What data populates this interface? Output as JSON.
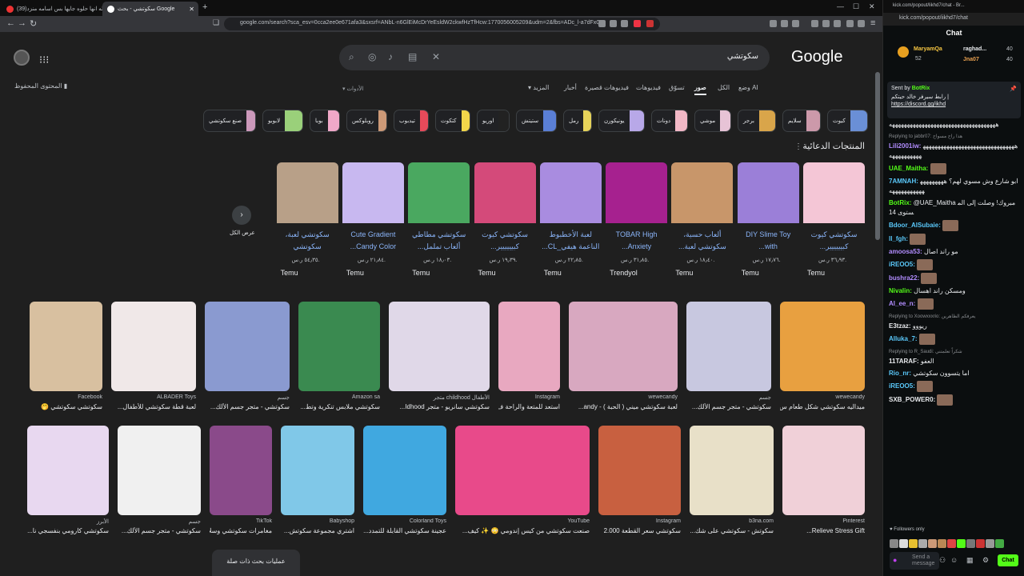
{
  "browser": {
    "tabs": [
      {
        "label": "(39)يالله انها حلوه جايها بس اسامه منزد"
      },
      {
        "label": "سكوتشي - بحث Google"
      }
    ],
    "url": "google.com/search?sca_esv=0cca2ee0e671afa3&sxsrf=ANbL-n6GlEiMcDrYeEsldW2ckwfHzTfHcw:1770056005209&udm=2&fbs=ADc_l-a7dFxQ..."
  },
  "google": {
    "logo": "Google",
    "query": "سكوتشي",
    "saved_content": "المحتوى المحفوظ",
    "tools": "الأدوات",
    "nav_tabs": [
      {
        "label": "وضع AI"
      },
      {
        "label": "الكل"
      },
      {
        "label": "صور"
      },
      {
        "label": "تسوّق"
      },
      {
        "label": "فيديوهات"
      },
      {
        "label": "فيديوهات قصيرة"
      },
      {
        "label": "أخبار"
      },
      {
        "label": "المزيد"
      }
    ],
    "chips": [
      {
        "label": "كيوت",
        "color": "#6a8fd6"
      },
      {
        "label": "سلايم",
        "color": "#c9a"
      },
      {
        "label": "برجر",
        "color": "#d9a54a"
      },
      {
        "label": "موشي",
        "color": "#e7c3d6"
      },
      {
        "label": "دونات",
        "color": "#f2b8c6"
      },
      {
        "label": "يونيكورن",
        "color": "#b8a8e8"
      },
      {
        "label": "رمل",
        "color": "#e6d35a"
      },
      {
        "label": "ستيتش",
        "color": "#5a7fd6"
      },
      {
        "label": "اوريو",
        "color": "#222"
      },
      {
        "label": "كتكوت",
        "color": "#f3d64a"
      },
      {
        "label": "تيدبوب",
        "color": "#e74a5a"
      },
      {
        "label": "روبلوكس",
        "color": "#c97"
      },
      {
        "label": "بوبا",
        "color": "#f0a8c8"
      },
      {
        "label": "لابوبو",
        "color": "#9ad07a"
      },
      {
        "label": "صنع سكوتشي",
        "color": "#c9b"
      }
    ],
    "sponsored_title": "المنتجات الدعائية",
    "view_all": "عرض الكل",
    "products": [
      {
        "title": "سكوتشي كيوت كبيييييير...",
        "price": "٣٦٫٩٣ ر.س.",
        "seller": "Temu",
        "color": "#f4c6d6"
      },
      {
        "title": "DIY Slime Toy with...",
        "price": "١٧٫٧٦ ر.س.",
        "seller": "Temu",
        "color": "#9b7fd8"
      },
      {
        "title": "ألعاب حسية، سكوتشي لعبة...",
        "price": "١٨٫٤٠ ر.س.",
        "seller": "Temu",
        "color": "#c8966a"
      },
      {
        "title": "TOBAR High Anxiety...",
        "price": "٣١٫٨٥ ر.س.",
        "seller": "Trendyol",
        "color": "#a6218f"
      },
      {
        "title": "لعبة الأخطبوط الناعمة هيفي_CL...",
        "price": "٢٢٫٨٥ ر.س.",
        "seller": "Temu",
        "color": "#a98ce0"
      },
      {
        "title": "سكوتشي كيوت كبيييييير...",
        "price": "١٩٫٣٩ ر.س.",
        "seller": "Temu",
        "color": "#d44a7a"
      },
      {
        "title": "سكوتشي مطاطي ألعاب تململ...",
        "price": "١٨٫٠٣ ر.س.",
        "seller": "Temu",
        "color": "#4aa860"
      },
      {
        "title": "Cute Gradient Candy Color...",
        "price": "٢١٫٨٤ ر.س.",
        "seller": "Temu",
        "color": "#c8b8f0"
      },
      {
        "title": "سكوتشي لعبة، سكوتشي للأطفال...",
        "price": "٥٤٫٣٥ ر.س.",
        "seller": "Temu",
        "color": "#b8a088"
      }
    ],
    "row1": [
      {
        "source": "wewecandy",
        "caption": "ميداليه سكوتشي شكل طعام س...",
        "color": "#e8a040"
      },
      {
        "source": "جسم",
        "caption": "سكوتشي - متجر جسم الألك...",
        "color": "#c8c8e0"
      },
      {
        "source": "wewecandy",
        "caption": "لعبة سكوتشي ميني ( الحبة ) - andy...",
        "color": "#d8a8c0"
      },
      {
        "source": "Instagram",
        "caption": "استعد للمتعة والراحة ف...",
        "color": "#e8a8c0"
      },
      {
        "source": "متجر childhood الأطفال",
        "caption": "سكوتشي سانريو - متجر Idhood...",
        "color": "#e0d8e8"
      },
      {
        "source": "Amazon sa",
        "caption": "سكوتشي ملابس تنكرية وتط...",
        "color": "#3a8a50"
      },
      {
        "source": "جسم",
        "caption": "سكوتشي - متجر جسم الألك...",
        "color": "#8a9ad0"
      },
      {
        "source": "ALBADER Toys",
        "caption": "لعبة قطة سكوتشي للأطفال...",
        "color": "#f0e8e8"
      },
      {
        "source": "Facebook",
        "caption": "سكوتشي سكوتشي 🤭",
        "color": "#d8c0a0"
      }
    ],
    "row2": [
      {
        "source": "Pinterest",
        "caption": "Relieve Stress Gift...",
        "color": "#f0d0d8"
      },
      {
        "source": "b3na.com",
        "caption": "سكوتش - سكوتشي على شك... - Toys",
        "color": "#e8e0c8"
      },
      {
        "source": "Instagram",
        "caption": "سكوتشي سعر القطعة 2.000",
        "color": "#c86040"
      },
      {
        "source": "YouTube",
        "caption": "صنعت سكوتشي من كيس إندومي 😳 ✨ كيف...",
        "color": "#e84a8a"
      },
      {
        "source": "Colorland Toys",
        "caption": "عجينة سكوتشي القابلة للتمدد...",
        "color": "#40a8e0"
      },
      {
        "source": "Babyshop",
        "caption": "اشتري مجموعة سكوتش...",
        "color": "#80c8e8"
      },
      {
        "source": "TikTok",
        "caption": "مغامرات سكوتشي وسلا...",
        "color": "#8a4a8a"
      },
      {
        "source": "جسم",
        "caption": "سكوتشي - متجر جسم الألك...",
        "color": "#f0f0f0"
      },
      {
        "source": "الأبرز",
        "caption": "سكوتشي كارومي بنفسجي نا...",
        "color": "#e8d8f0"
      }
    ],
    "related": "عمليات بحث ذات صلة"
  },
  "chat": {
    "tab_url": "kick.com/popout/likhd7/chat - Br...",
    "url": "kick.com/popout/iikhd7/chat",
    "title": "Chat",
    "leaderboard": [
      {
        "name": "MaryamQa",
        "count": "52"
      },
      {
        "name": "raghad...",
        "count": "40"
      },
      {
        "name": "Jna07",
        "count": "40"
      }
    ],
    "pinned": {
      "sent_by": "Sent by",
      "bot": "BotRix",
      "text": "| رابط سيرفر خالد حيتكم",
      "link": "https://discord.gg/ikhd"
    },
    "messages": [
      {
        "user": "",
        "text": "ههههههههههههههههههههههههههههههههههههه",
        "reply": "",
        "color": "#e8eaed"
      },
      {
        "user": "Lili2001iw:",
        "text": "ههههههههههههههههههههههههههههههههههههههههههه",
        "reply": "Replying to jabbr07: هذا راح مسواح",
        "color": "#b28dff"
      },
      {
        "user": "UAE_Maitha:",
        "text": "",
        "reply": "",
        "color": "#53fc18"
      },
      {
        "user": "7AMNAH:",
        "text": "ابو شارع وش مسوي لهم؟ ههههههههههههههههههههه",
        "reply": "",
        "color": "#5ac8fa"
      },
      {
        "user": "BotRix:",
        "text": "@UAE_Maitha مبروك! وصلت إلى المستوى 14",
        "reply": "",
        "color": "#53fc18"
      },
      {
        "user": "Bdoor_AlSubaie:",
        "text": "",
        "reply": "",
        "color": "#5ac8fa"
      },
      {
        "user": "ll_fgh:",
        "text": "",
        "reply": "",
        "color": "#5ac8fa"
      },
      {
        "user": "amoosa53:",
        "text": "مو راند اصال",
        "reply": "",
        "color": "#b28dff"
      },
      {
        "user": "iREOO5:",
        "text": "",
        "reply": "",
        "color": "#5ac8fa"
      },
      {
        "user": "bushra22:",
        "text": "",
        "reply": "",
        "color": "#b28dff"
      },
      {
        "user": "Nivalin:",
        "text": "ومسكن راند اهسال",
        "reply": "",
        "color": "#53fc18"
      },
      {
        "user": "Al_ee_n:",
        "text": "",
        "reply": "",
        "color": "#b28dff"
      },
      {
        "user": "E3tzaz:",
        "text": "ريووو",
        "reply": "Replying to Xoowxxxrio: يعرفكم الظاهرين",
        "color": "#e8eaed"
      },
      {
        "user": "Alluka_7:",
        "text": "",
        "reply": "",
        "color": "#5ac8fa"
      },
      {
        "user": "11TARAF:",
        "text": "العفو",
        "reply": "Replying to R_Saudi: شكراً تعلمتني",
        "color": "#e8eaed"
      },
      {
        "user": "Rio_nr:",
        "text": "اما يتسوون سكوتشي",
        "reply": "",
        "color": "#5ac8fa"
      },
      {
        "user": "iREOO5:",
        "text": "",
        "reply": "",
        "color": "#5ac8fa"
      },
      {
        "user": "SXB_POWER0:",
        "text": "",
        "reply": "",
        "color": "#e8eaed"
      }
    ],
    "followers_only": "Followers only",
    "input_placeholder": "Send a message",
    "send": "Chat"
  }
}
